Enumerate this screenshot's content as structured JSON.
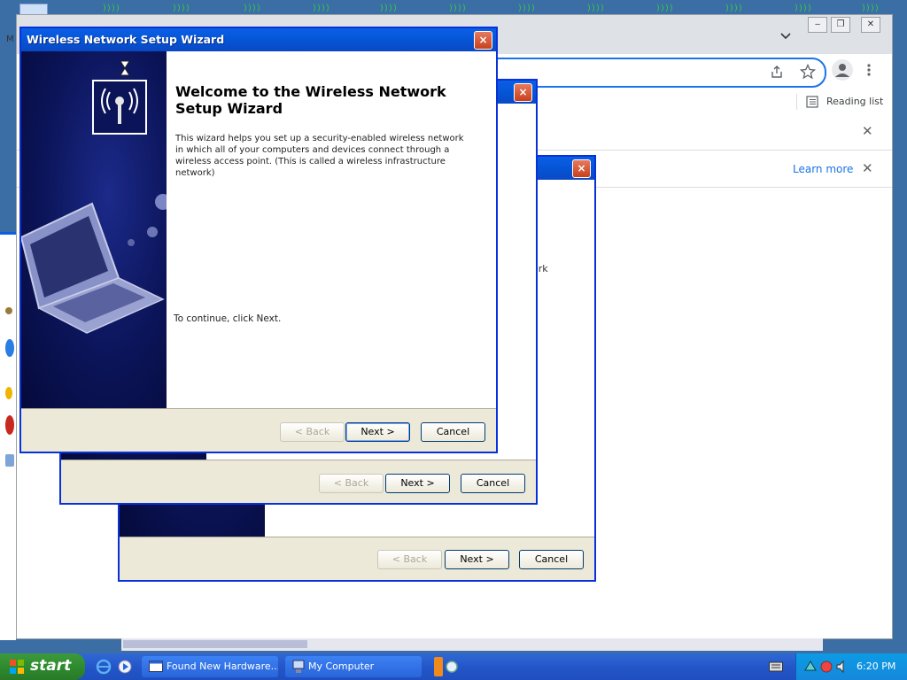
{
  "wizard": {
    "title": "Wireless Network Setup Wizard",
    "close_label": "×",
    "heading": "Welcome to the Wireless Network Setup Wizard",
    "body": "This wizard helps you set up a security-enabled wireless network in which all of your computers and devices connect through a wireless access point. (This is called a wireless infrastructure network)",
    "continue_text": "To continue, click Next.",
    "back_label": "< Back",
    "next_label": "Next >",
    "cancel_label": "Cancel"
  },
  "wizard_copy_2": {
    "close_label": "×",
    "back_label": "< Back",
    "next_label": "Next >",
    "cancel_label": "Cancel"
  },
  "wizard_copy_3": {
    "close_label": "×",
    "partial_text": "ork",
    "back_label": "< Back",
    "next_label": "Next >",
    "cancel_label": "Cancel"
  },
  "browser": {
    "tab_partial": "M",
    "reading_list_label": "Reading list",
    "learn_more_label": "Learn more",
    "close_glyph": "✕",
    "minimize_glyph": "‒",
    "restore_glyph": "❐",
    "max_close_glyph": "✕"
  },
  "desktop": {
    "wifi_glyph": "))))"
  },
  "taskbar": {
    "start_label": "start",
    "tasks": [
      {
        "label": "Found New Hardware..."
      },
      {
        "label": "My Computer"
      }
    ],
    "clock": "6:20 PM"
  },
  "colors": {
    "xp_blue": "#0a5fe6",
    "chrome_accent": "#1a73e8",
    "start_green": "#2e8b2e"
  }
}
